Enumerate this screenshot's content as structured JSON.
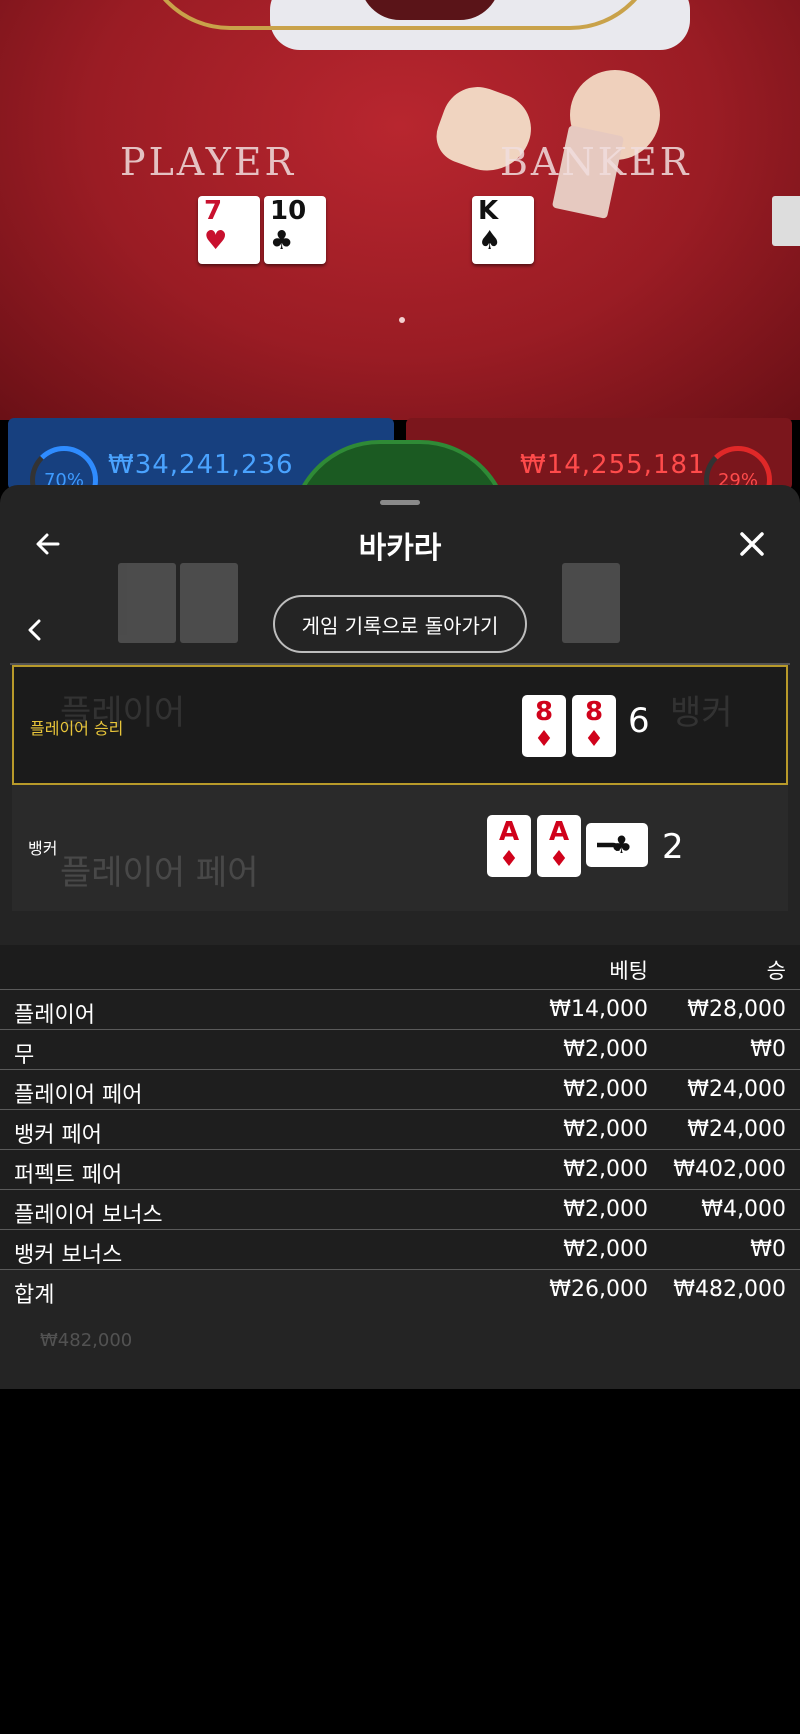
{
  "video": {
    "player_label": "PLAYER",
    "banker_label": "BANKER",
    "player_cards": [
      {
        "rank": "7",
        "suit": "♥",
        "color": "red"
      },
      {
        "rank": "10",
        "suit": "♣",
        "color": "black"
      }
    ],
    "banker_cards": [
      {
        "rank": "K",
        "suit": "♠",
        "color": "black"
      }
    ]
  },
  "summary": {
    "player_amount": "₩34,241,236",
    "player_percent": "70%",
    "banker_amount": "₩14,255,181",
    "banker_percent": "29%"
  },
  "sheet": {
    "title": "바카라",
    "return_label": "게임 기록으로 돌아가기",
    "player_result": {
      "label": "플레이어 승리",
      "cards": [
        {
          "rank": "8",
          "suit": "♦"
        },
        {
          "rank": "8",
          "suit": "♦"
        }
      ],
      "score": "6"
    },
    "banker_result": {
      "label": "뱅커",
      "cards": [
        {
          "rank": "A",
          "suit": "♦"
        },
        {
          "rank": "A",
          "suit": "♦"
        }
      ],
      "side_card": {
        "rank": "J",
        "suit": "♣"
      },
      "score": "2"
    },
    "table": {
      "headers": {
        "bet": "베팅",
        "win": "승"
      },
      "rows": [
        {
          "label": "플레이어",
          "bet": "₩14,000",
          "win": "₩28,000"
        },
        {
          "label": "무",
          "bet": "₩2,000",
          "win": "₩0"
        },
        {
          "label": "플레이어 페어",
          "bet": "₩2,000",
          "win": "₩24,000"
        },
        {
          "label": "뱅커 페어",
          "bet": "₩2,000",
          "win": "₩24,000"
        },
        {
          "label": "퍼펙트 페어",
          "bet": "₩2,000",
          "win": "₩402,000"
        },
        {
          "label": "플레이어 보너스",
          "bet": "₩2,000",
          "win": "₩4,000"
        },
        {
          "label": "뱅커 보너스",
          "bet": "₩2,000",
          "win": "₩0"
        }
      ],
      "total": {
        "label": "합계",
        "bet": "₩26,000",
        "win": "₩482,000"
      }
    }
  },
  "colors": {
    "player_blue": "#2f8cff",
    "banker_red": "#e02828",
    "win_highlight": "#b89a2a",
    "sheet_bg": "#242424"
  },
  "icons": {
    "back": "arrow-left-icon",
    "close": "close-icon",
    "prev": "chevron-left-icon"
  }
}
